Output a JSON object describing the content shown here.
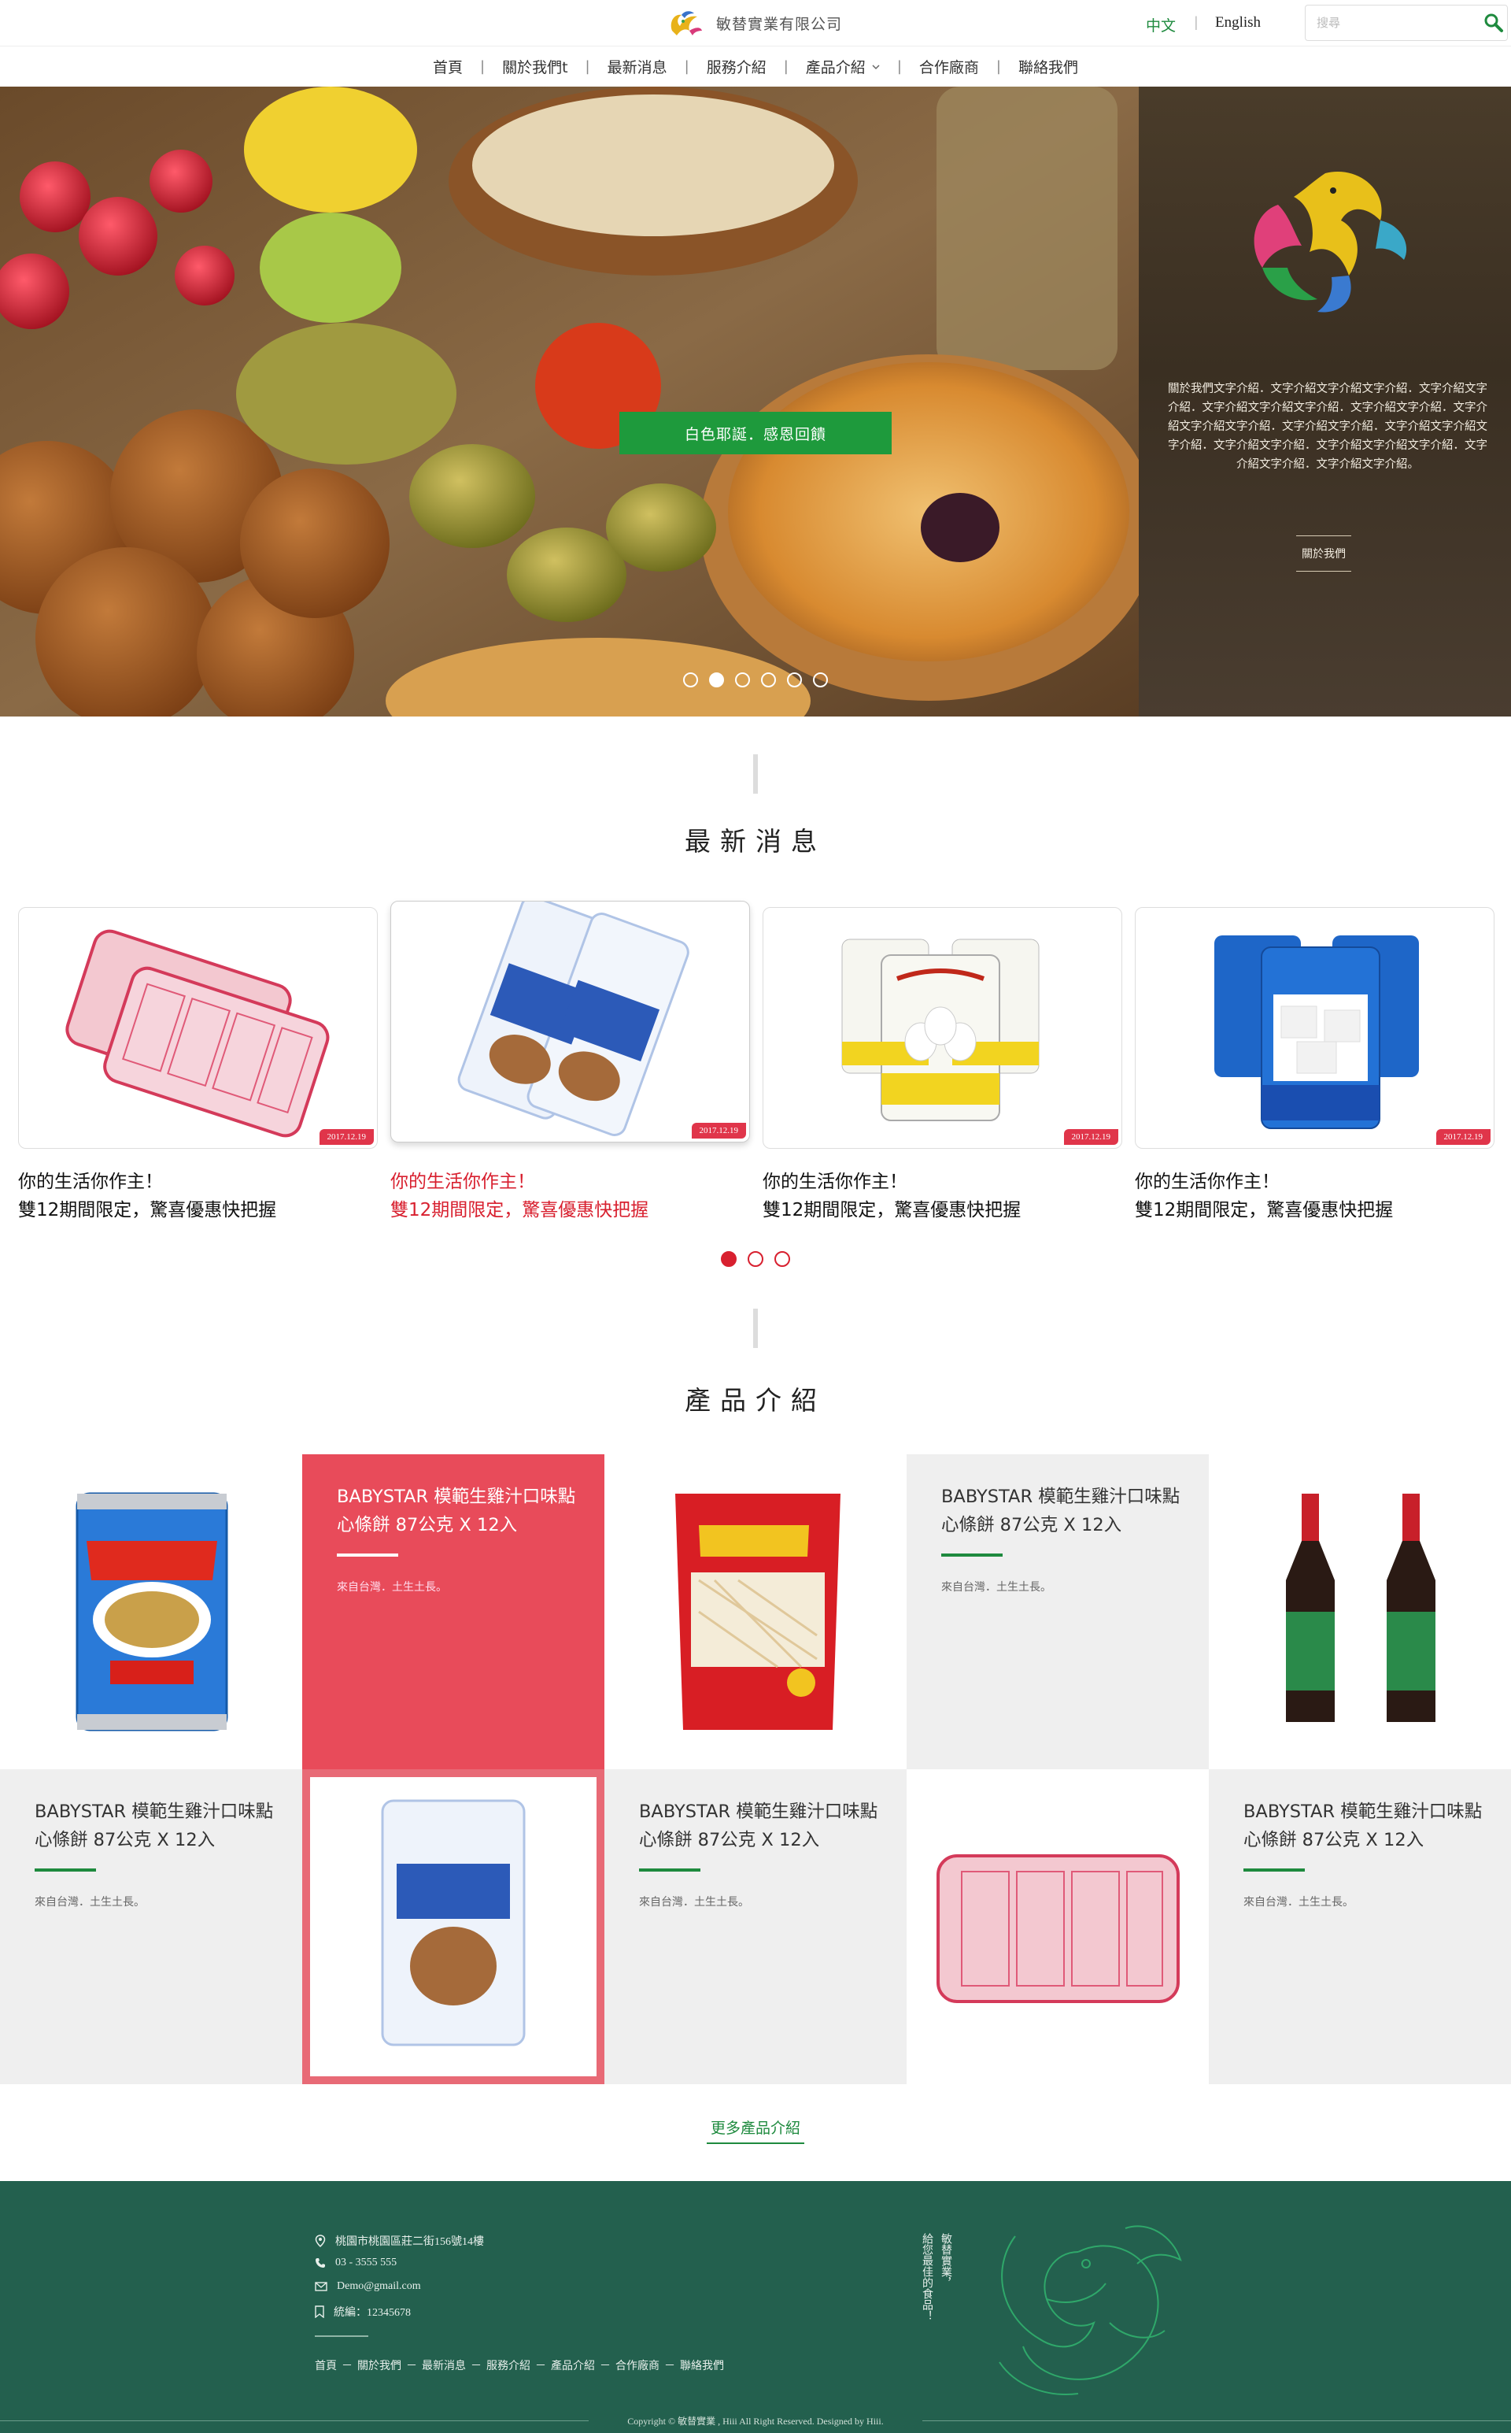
{
  "header": {
    "company": "敏替實業有限公司",
    "lang_zh": "中文",
    "lang_sep": "|",
    "lang_en": "English",
    "search_placeholder": "搜尋"
  },
  "nav": {
    "items": [
      "首頁",
      "關於我們t",
      "最新消息",
      "服務介紹",
      "產品介紹",
      "合作廠商",
      "聯絡我們"
    ],
    "separator": "|"
  },
  "hero": {
    "cta": "白色耶誕．感恩回饋",
    "about_text": "關於我們文字介紹．文字介紹文字介紹文字介紹．文字介紹文字介紹．文字介紹文字介紹文字介紹．文字介紹文字介紹．文字介紹文字介紹文字介紹．文字介紹文字介紹．文字介紹文字介紹文字介紹．文字介紹文字介紹．文字介紹文字介紹文字介紹．文字介紹文字介紹．文字介紹文字介紹。",
    "about_link": "關於我們",
    "slides_total": 6,
    "active_slide": 2
  },
  "news": {
    "title": "最新消息",
    "items": [
      {
        "date": "2017.12.19",
        "line1": "你的生活你作主！",
        "line2": "雙12期間限定，驚喜優惠快把握"
      },
      {
        "date": "2017.12.19",
        "line1": "你的生活你作主！",
        "line2": "雙12期間限定，驚喜優惠快把握"
      },
      {
        "date": "2017.12.19",
        "line1": "你的生活你作主！",
        "line2": "雙12期間限定，驚喜優惠快把握"
      },
      {
        "date": "2017.12.19",
        "line1": "你的生活你作主！",
        "line2": "雙12期間限定，驚喜優惠快把握"
      }
    ],
    "pages_total": 3,
    "active_page": 1
  },
  "products": {
    "title": "產品介紹",
    "item_name": "BABYSTAR 模範生雞汁口味點心條餅 87公克 X 12入",
    "item_sub": "來自台灣．土生土長。",
    "more_link": "更多產品介紹"
  },
  "footer": {
    "address": "桃園市桃園區莊二街156號14樓",
    "phone": "03 - 3555 555",
    "email": "Demo@gmail.com",
    "tax_id": "統編：12345678",
    "links": [
      "首頁",
      "關於我們",
      "最新消息",
      "服務介紹",
      "產品介紹",
      "合作廠商",
      "聯絡我們"
    ],
    "link_sep": "－",
    "slogan_col1": "敏替實業，",
    "slogan_col2": "給您最佳的食品！",
    "copyright": "Copyright © 敏替實業 , Hiii All Right Reserved. Designed by Hiii."
  },
  "colors": {
    "brand_green": "#1e8a3e",
    "footer_green": "#23604e",
    "accent_red": "#d8202f",
    "card_red": "#e84b5a"
  }
}
